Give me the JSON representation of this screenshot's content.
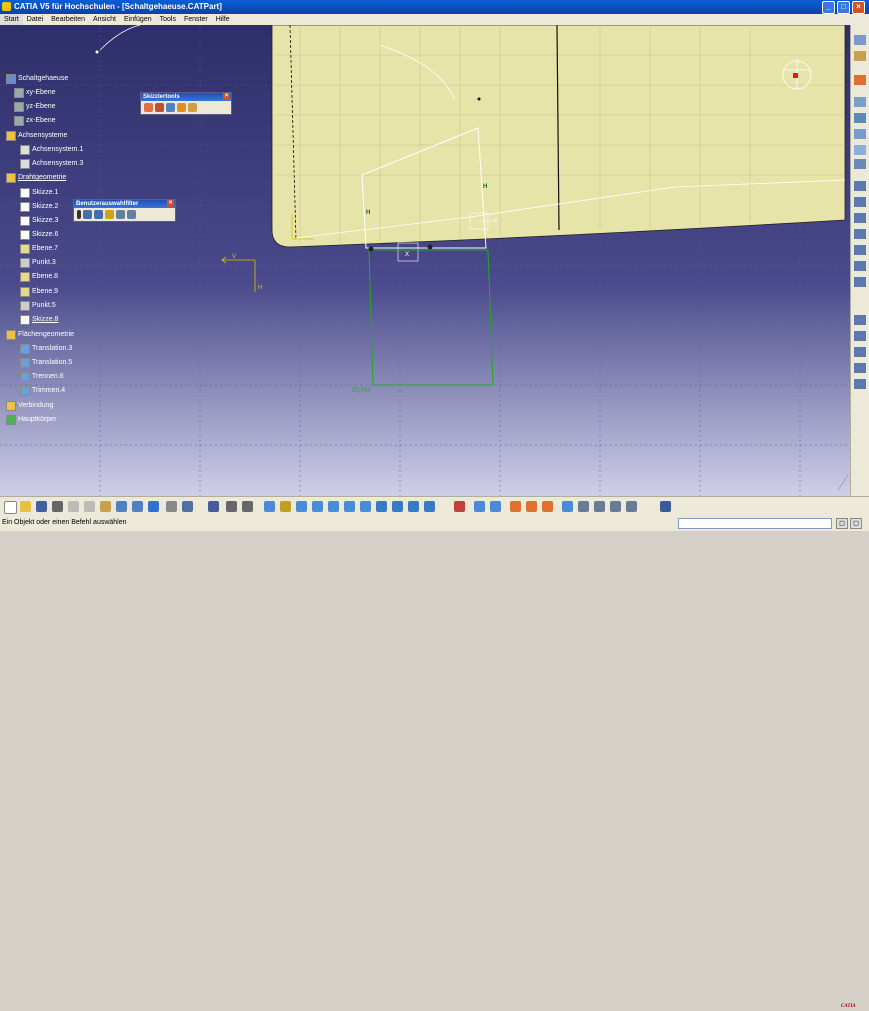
{
  "window": {
    "title": "CATIA V5 für Hochschulen - [Schaltgehaeuse.CATPart]"
  },
  "window_buttons": {
    "minimize": "_",
    "maximize": "□",
    "close": "×"
  },
  "menu": [
    "Start",
    "Datei",
    "Bearbeiten",
    "Ansicht",
    "Einfügen",
    "Tools",
    "Fenster",
    "Hilfe"
  ],
  "tree": {
    "root": "Schaltgehaeuse",
    "planes": [
      "xy-Ebene",
      "yz-Ebene",
      "zx-Ebene"
    ],
    "axis_group": "Achsensysteme",
    "axis_items": [
      "Achsensystem.1",
      "Achsensystem.3"
    ],
    "wire_group": "Drahtgeometrie",
    "wire_items": [
      "Skizze.1",
      "Skizze.2",
      "Skizze.3",
      "Skizze.6",
      "Ebene.7",
      "Punkt.3",
      "Ebene.8",
      "Ebene.9",
      "Punkt.5",
      "Skizze.8"
    ],
    "surface_group": "Flächengeometrie",
    "surface_items": [
      "Translation.3",
      "Translation.5",
      "Trennen.6",
      "Trimmen.4"
    ],
    "connection": "Verbindung",
    "body": "Hauptkörper"
  },
  "sketch_tools": {
    "title": "Skizziertools"
  },
  "user_filter": {
    "title": "Benutzerauswahlfilter"
  },
  "viewport": {
    "dimension": "20,704",
    "label_h": "H",
    "label_v": "V",
    "label_y": "Y",
    "label_x": "X"
  },
  "colors": {
    "background_top": "#2e2e6a",
    "background_bottom": "#cfcfe8",
    "surface": "#e6e4a8",
    "sketch": "#22aa22"
  },
  "status": {
    "message": "Ein Objekt oder einen Befehl auswählen",
    "input_value": ""
  },
  "logo": {
    "text": "CATIA"
  }
}
